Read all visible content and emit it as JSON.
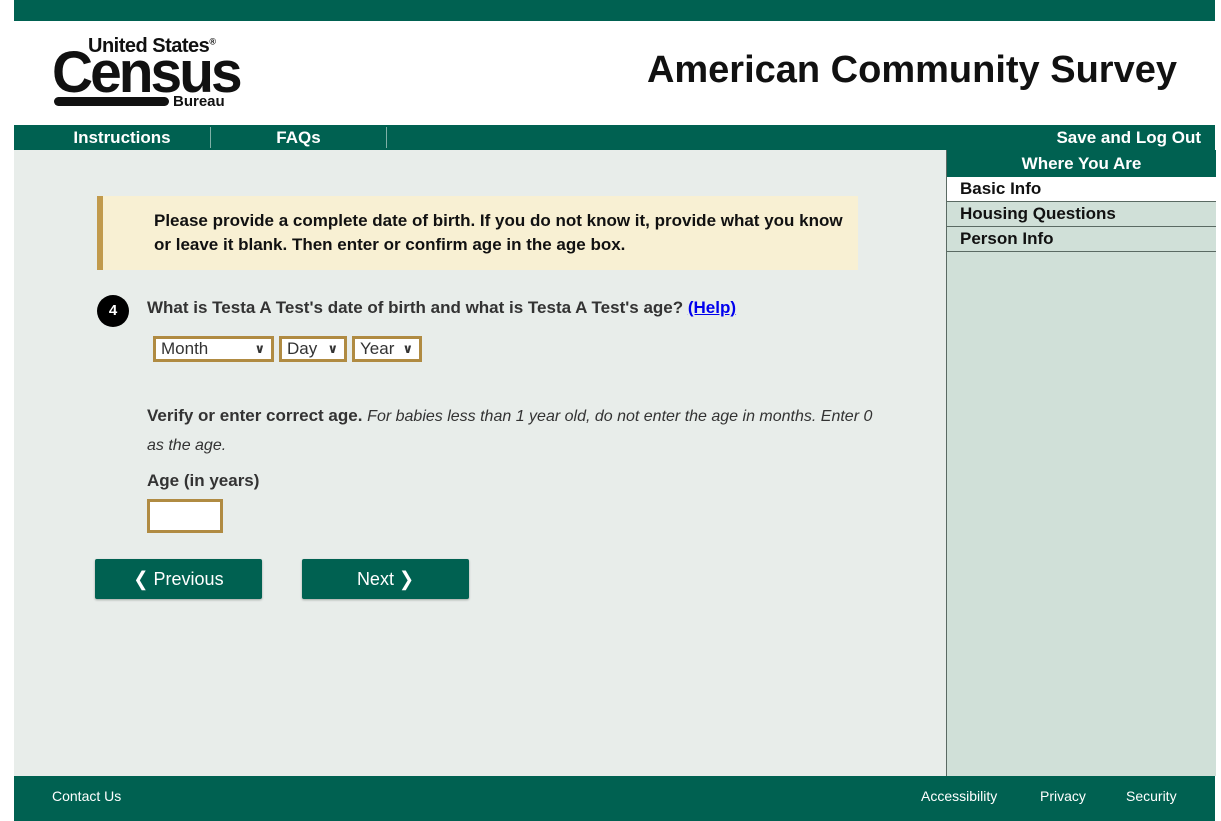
{
  "header": {
    "logo": {
      "line1": "United States",
      "registered": "®",
      "wordmark": "Census",
      "line3": "Bureau"
    },
    "title": "American Community Survey"
  },
  "nav": {
    "instructions": "Instructions",
    "faqs": "FAQs",
    "save_logout": "Save and Log Out"
  },
  "sidebar": {
    "heading": "Where You Are",
    "items": [
      {
        "label": "Basic Info",
        "active": true
      },
      {
        "label": "Housing Questions",
        "active": false
      },
      {
        "label": "Person Info",
        "active": false
      }
    ]
  },
  "notice": {
    "text": "Please provide a complete date of birth. If you do not know it, provide what you know or leave it blank. Then enter or confirm age in the age box."
  },
  "question": {
    "number": "4",
    "text": "What is Testa A Test's date of birth and what is Testa A Test's age?",
    "help_link": "(Help)"
  },
  "dob": {
    "month": "Month",
    "day": "Day",
    "year": "Year"
  },
  "verify": {
    "bold": "Verify or enter correct age.",
    "italic": "For babies less than 1 year old, do not enter the age in months. Enter 0 as the age."
  },
  "age": {
    "label": "Age (in years)",
    "value": ""
  },
  "buttons": {
    "previous": "Previous",
    "next": "Next"
  },
  "footer": {
    "contact": "Contact Us",
    "accessibility": "Accessibility",
    "privacy": "Privacy",
    "security": "Security"
  },
  "colors": {
    "brand_green": "#006151",
    "accent_gold": "#b08b42",
    "notice_bg": "#f8f0d3",
    "main_bg": "#e8edea",
    "sidebar_bg": "#d0e0d8"
  }
}
